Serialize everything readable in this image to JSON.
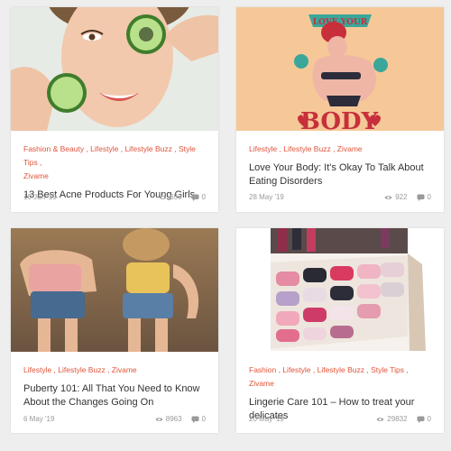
{
  "colors": {
    "accent": "#e0543a",
    "muted": "#9a9a9a",
    "title": "#333333"
  },
  "articles": [
    {
      "categories": "Fashion & Beauty , Lifestyle , Lifestyle Buzz , Style Tips ,\nZivame",
      "title": "13 Best Acne Products For Young Girls",
      "date": "10 Jun '19",
      "views": "650",
      "comments": "0",
      "image_icon": "face-with-cucumbers-image"
    },
    {
      "categories": "Lifestyle , Lifestyle Buzz , Zivame",
      "title": "Love Your Body: It's Okay To Talk About Eating Disorders",
      "date": "28 May '19",
      "views": "922",
      "comments": "0",
      "image_icon": "body-positive-illustration",
      "image_text_top": "LOVE YOUR",
      "image_text_bottom": "BODY"
    },
    {
      "categories": "Lifestyle , Lifestyle Buzz , Zivame",
      "title": "Puberty 101: All That You Need to Know About the Changes Going On",
      "date": "6 May '19",
      "views": "8963",
      "comments": "0",
      "image_icon": "friends-piggyback-image"
    },
    {
      "categories": "Fashion , Lifestyle , Lifestyle Buzz , Style Tips , Zivame",
      "title": "Lingerie Care 101 – How to treat your delicates",
      "date": "20 May '19",
      "views": "29832",
      "comments": "0",
      "image_icon": "lingerie-drawer-image"
    }
  ]
}
